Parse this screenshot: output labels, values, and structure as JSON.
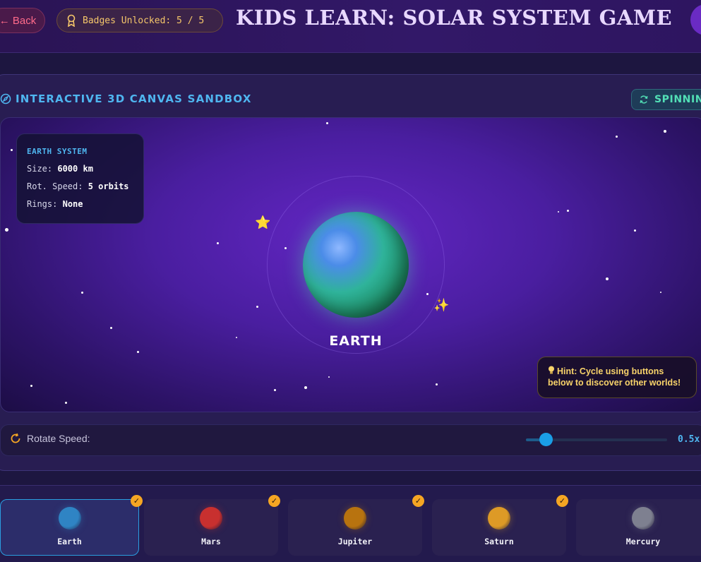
{
  "header": {
    "back_label": "← Back",
    "badges_label": "Badges Unlocked: 5 / 5",
    "title": "KIDS LEARN: SOLAR SYSTEM GAME"
  },
  "sandbox": {
    "title": "INTERACTIVE 3D CANVAS SANDBOX",
    "status": "SPINNING",
    "info": {
      "title": "EARTH SYSTEM",
      "size_label": "Size:",
      "size_value": "6000 km",
      "speed_label": "Rot. Speed:",
      "speed_value": "5 orbits",
      "rings_label": "Rings:",
      "rings_value": "None"
    },
    "planet_label": "EARTH",
    "hint_line1": "Hint: Cycle using buttons",
    "hint_line2": "below to discover other worlds!",
    "deco_star1": "⭐",
    "deco_star2": "✨"
  },
  "speed": {
    "label": "Rotate Speed:",
    "value": "0.5x",
    "fraction": 0.14
  },
  "planets": [
    {
      "name": "Earth",
      "color": "#2f84c4",
      "unlocked": true,
      "active": true
    },
    {
      "name": "Mars",
      "color": "#c8302f",
      "unlocked": true,
      "active": false
    },
    {
      "name": "Jupiter",
      "color": "#b8730f",
      "unlocked": true,
      "active": false
    },
    {
      "name": "Saturn",
      "color": "#dd9a26",
      "unlocked": true,
      "active": false
    },
    {
      "name": "Mercury",
      "color": "#7e8090",
      "unlocked": false,
      "active": false
    }
  ],
  "check_glyph": "✓",
  "colors": {
    "accent": "#4fb6f0",
    "gold": "#f5a623",
    "back": "#ff6b8a",
    "spinning": "#52e0b6"
  },
  "icons": {
    "badge": "award-icon",
    "sandbox": "compass-icon",
    "spinning": "refresh-icon",
    "speed": "rotate-icon",
    "hint": "lightbulb-icon"
  }
}
